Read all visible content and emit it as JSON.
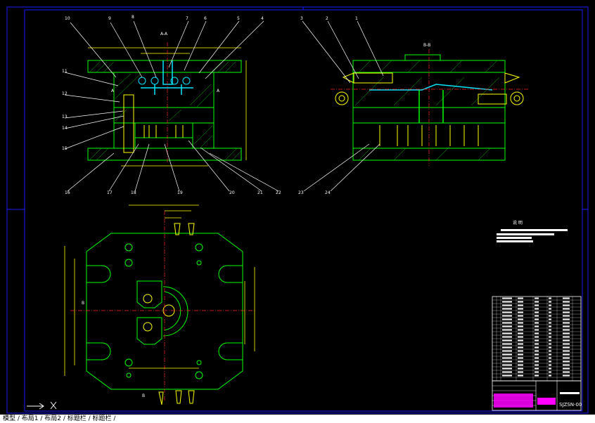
{
  "drawing": {
    "section_aa_label": "A-A",
    "section_bb_label": "B-B",
    "callouts_top": [
      "10",
      "9",
      "8",
      "7",
      "6",
      "5",
      "4",
      "3",
      "2",
      "1"
    ],
    "callouts_left": [
      "11",
      "12",
      "13",
      "14",
      "15"
    ],
    "callouts_bottom": [
      "16",
      "17",
      "18",
      "19",
      "20",
      "21",
      "22",
      "23",
      "24"
    ],
    "notes_title": "说 明",
    "drawing_number": "SJZSN-00",
    "view_markers": [
      "A",
      "A",
      "B",
      "B"
    ]
  },
  "statusbar": {
    "command_text": "模型 / 布局1 / 布局2 / 标题栏 / 标题栏 /"
  },
  "colors": {
    "background": "#000000",
    "border": "#1a1aff",
    "body": "#00ff00",
    "dimension": "#ffff00",
    "centerline": "#ff2020",
    "cyan": "#00e5ff",
    "white": "#ffffff",
    "magenta": "#ff00ff"
  }
}
